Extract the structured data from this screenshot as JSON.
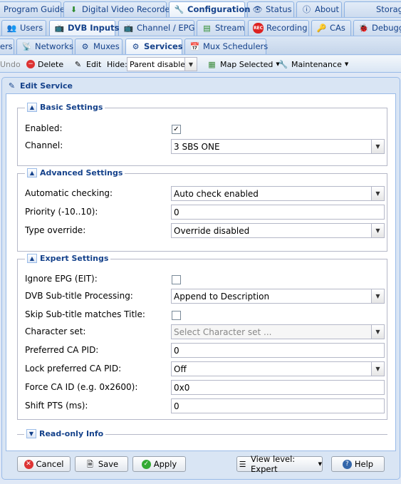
{
  "tabs_row1": [
    {
      "label": "Program Guide",
      "icon": "none"
    },
    {
      "label": "Digital Video Recorder",
      "icon": "download-icon"
    },
    {
      "label": "Configuration",
      "icon": "wrench-icon"
    },
    {
      "label": "Status",
      "icon": "eye-icon"
    },
    {
      "label": "About",
      "icon": "info-icon"
    },
    {
      "label": "Storag",
      "icon": "none"
    }
  ],
  "tabs_row2": [
    {
      "label": "Users",
      "icon": "users-icon"
    },
    {
      "label": "DVB Inputs",
      "icon": "tv-icon"
    },
    {
      "label": "Channel / EPG",
      "icon": "tv-icon"
    },
    {
      "label": "Stream",
      "icon": "stream-icon"
    },
    {
      "label": "Recording",
      "icon": "rec-icon"
    },
    {
      "label": "CAs",
      "icon": "key-icon"
    },
    {
      "label": "Debugg",
      "icon": "bug-icon"
    }
  ],
  "tabs_row3": [
    {
      "label": "ers",
      "icon": "none"
    },
    {
      "label": "Networks",
      "icon": "antenna-icon"
    },
    {
      "label": "Muxes",
      "icon": "mux-icon"
    },
    {
      "label": "Services",
      "icon": "services-icon"
    },
    {
      "label": "Mux Schedulers",
      "icon": "calendar-icon"
    }
  ],
  "toolbar": {
    "undo": "Undo",
    "delete": "Delete",
    "edit": "Edit",
    "hide_label": "Hide:",
    "hide_value": "Parent disabled",
    "map_selected": "Map Selected",
    "maintenance": "Maintenance"
  },
  "window": {
    "title": "Edit Service",
    "basic": {
      "legend": "Basic Settings",
      "enabled_label": "Enabled:",
      "enabled_checked": "✓",
      "channel_label": "Channel:",
      "channel_value": "3 SBS ONE"
    },
    "advanced": {
      "legend": "Advanced Settings",
      "auto_label": "Automatic checking:",
      "auto_value": "Auto check enabled",
      "priority_label": "Priority (-10..10):",
      "priority_value": "0",
      "type_label": "Type override:",
      "type_value": "Override disabled"
    },
    "expert": {
      "legend": "Expert Settings",
      "ignore_epg_label": "Ignore EPG (EIT):",
      "subtitle_label": "DVB Sub-title Processing:",
      "subtitle_value": "Append to Description",
      "skip_label": "Skip Sub-title matches Title:",
      "charset_label": "Character set:",
      "charset_placeholder": "Select Character set ...",
      "pref_ca_label": "Preferred CA PID:",
      "pref_ca_value": "0",
      "lock_ca_label": "Lock preferred CA PID:",
      "lock_ca_value": "Off",
      "force_ca_label": "Force CA ID (e.g. 0x2600):",
      "force_ca_value": "0x0",
      "shift_pts_label": "Shift PTS (ms):",
      "shift_pts_value": "0"
    },
    "readonly": {
      "legend": "Read-only Info"
    },
    "buttons": {
      "cancel": "Cancel",
      "save": "Save",
      "apply": "Apply",
      "view_level": "View level: Expert",
      "help": "Help"
    }
  },
  "colors": {
    "accent": "#15428b",
    "border": "#99bbe8",
    "bg": "#dfe8f6"
  }
}
